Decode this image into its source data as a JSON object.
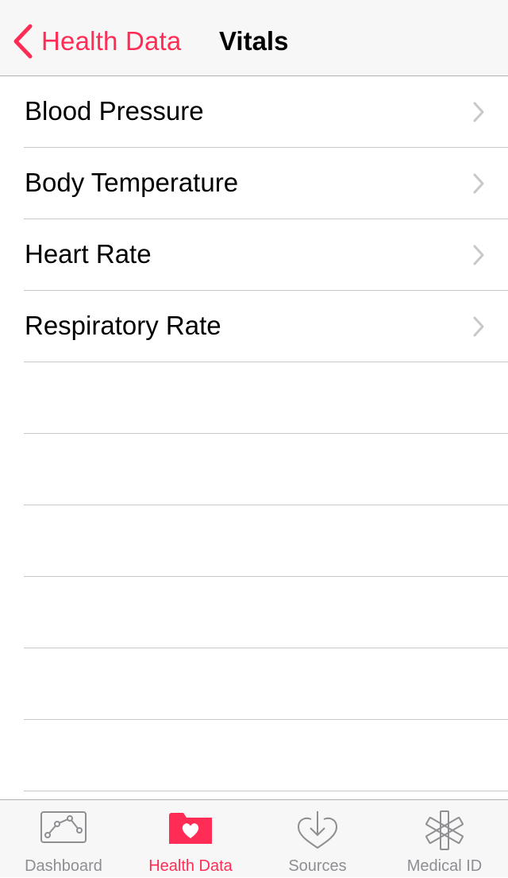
{
  "colors": {
    "accent": "#ff2d55",
    "tab_inactive": "#8e8e93",
    "chevron": "#c7c7cc",
    "separator": "#c8c7cc"
  },
  "navbar": {
    "back_label": "Health Data",
    "title": "Vitals"
  },
  "list": {
    "items": [
      {
        "label": "Blood Pressure",
        "icon": "chevron-right-icon"
      },
      {
        "label": "Body Temperature",
        "icon": "chevron-right-icon"
      },
      {
        "label": "Heart Rate",
        "icon": "chevron-right-icon"
      },
      {
        "label": "Respiratory Rate",
        "icon": "chevron-right-icon"
      }
    ]
  },
  "tabbar": {
    "tabs": [
      {
        "label": "Dashboard",
        "icon": "chart-icon",
        "selected": false
      },
      {
        "label": "Health Data",
        "icon": "health-folder-icon",
        "selected": true
      },
      {
        "label": "Sources",
        "icon": "heart-download-icon",
        "selected": false
      },
      {
        "label": "Medical ID",
        "icon": "asterisk-icon",
        "selected": false
      }
    ]
  }
}
